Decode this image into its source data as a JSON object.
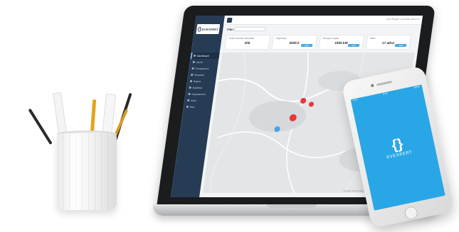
{
  "app": {
    "brand": "EVEXPERT",
    "logo_glyph": "{}",
    "user_text": "Lyon Region | Account Admin ▾",
    "filter": {
      "label": "Filtri",
      "selected": ""
    },
    "sidebar": {
      "items": [
        {
          "label": "Dashboard",
          "icon": "dashboard-icon",
          "active": true
        },
        {
          "label": "Utenti",
          "icon": "users-icon",
          "active": false
        },
        {
          "label": "Prenotazioni",
          "icon": "calendar-icon",
          "active": false
        },
        {
          "label": "Ricariche",
          "icon": "bolt-icon",
          "active": false
        },
        {
          "label": "Report",
          "icon": "report-icon",
          "active": false
        },
        {
          "label": "Notifiche",
          "icon": "bell-icon",
          "active": false
        },
        {
          "label": "Impostazioni",
          "icon": "gear-icon",
          "active": false
        },
        {
          "label": "Aiuto",
          "icon": "help-icon",
          "active": false
        },
        {
          "label": "Esci",
          "icon": "logout-icon",
          "active": false
        }
      ]
    },
    "cards": [
      {
        "title": "Totale ricariche effettuate",
        "value": "205",
        "button": "Vedi"
      },
      {
        "title": "Pagamenti",
        "value": "2029 €",
        "button": "Vedi"
      },
      {
        "title": "Energia erogata",
        "value": "1905 kW",
        "button": "Vedi"
      },
      {
        "title": "Utenti",
        "value": "17 attivi",
        "button": "Vedi"
      }
    ],
    "map": {
      "credit": "Map data ©2020 Google  Terms of Use  Report a map error",
      "markers": [
        {
          "color": "#e8373b"
        },
        {
          "color": "#e8373b"
        },
        {
          "color": "#e8373b"
        },
        {
          "color": "#4aa3dd"
        },
        {
          "color": "#4aa3dd"
        }
      ]
    }
  },
  "phone": {
    "status_left": "•••••",
    "status_time": "9:41",
    "status_right": "100%",
    "brand": "EVEXPERT",
    "logo_glyph": "{}",
    "screen_color": "#29a6e6"
  },
  "colors": {
    "sidebar": "#263c55",
    "accent": "#49a9e0",
    "marker_red": "#e8373b",
    "marker_blue": "#4aa3dd"
  }
}
